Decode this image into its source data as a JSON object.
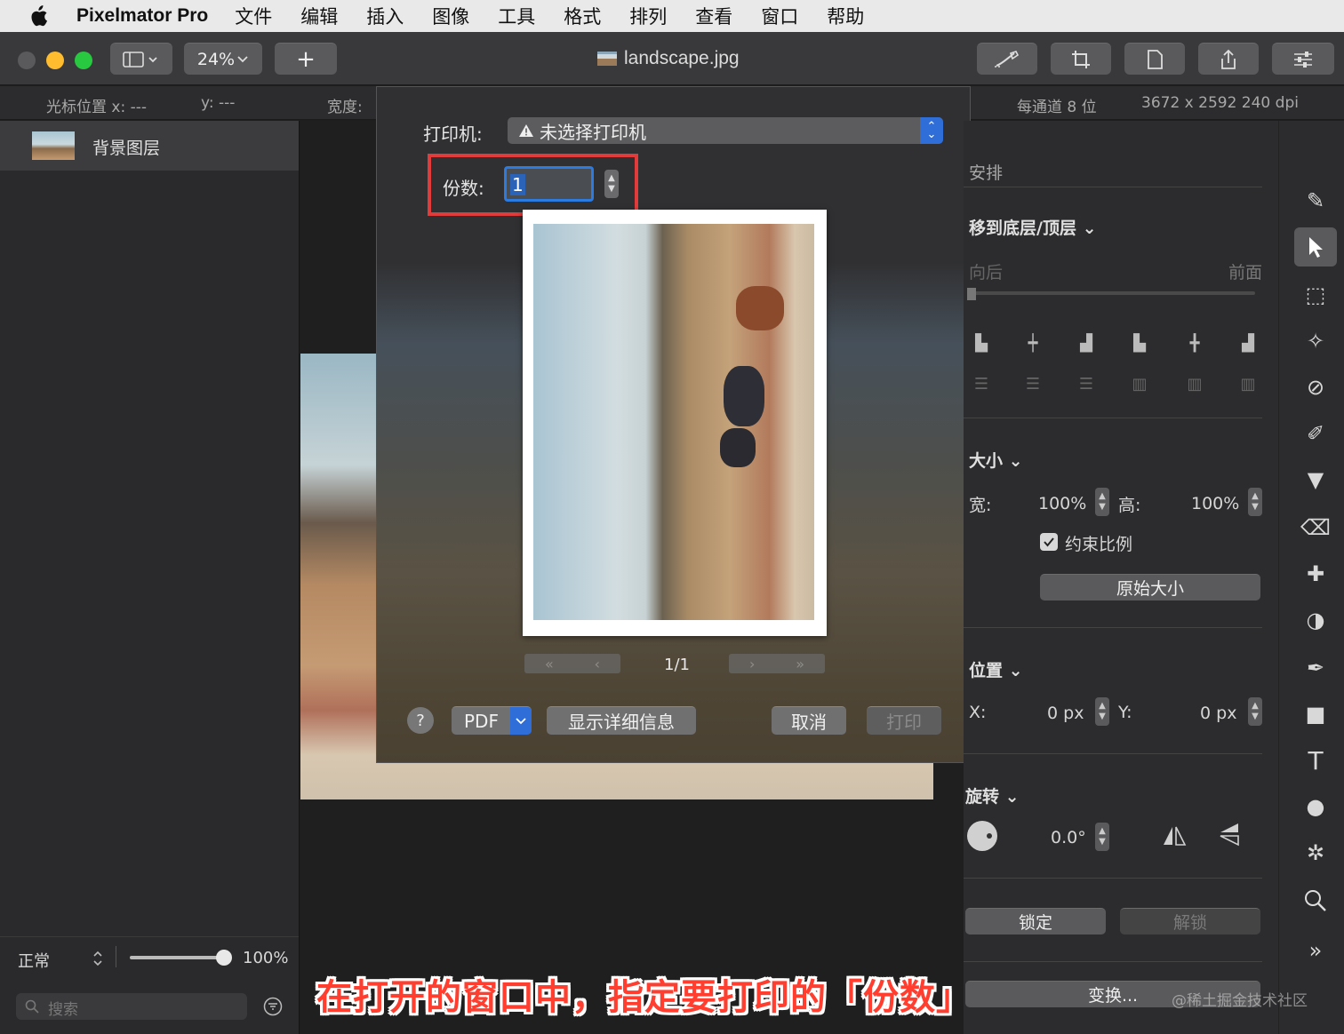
{
  "menubar": {
    "app_name": "Pixelmator Pro",
    "items": [
      "文件",
      "编辑",
      "插入",
      "图像",
      "工具",
      "格式",
      "排列",
      "查看",
      "窗口",
      "帮助"
    ]
  },
  "toolbar": {
    "zoom": "24%",
    "add_label": "+",
    "document_title": "landscape.jpg"
  },
  "infostrip": {
    "cursor_x": "光标位置 x:  ---",
    "cursor_y": "y:  ---",
    "width_label": "宽度:",
    "bits": "每通道 8 位",
    "size": "3672 x 2592 240 dpi"
  },
  "layers": {
    "items": [
      {
        "name": "背景图层"
      }
    ],
    "blend_mode": "正常",
    "opacity": "100%",
    "opacity_fraction": 1.0,
    "search_placeholder": "搜索"
  },
  "print_dialog": {
    "printer_label": "打印机:",
    "printer_value": "未选择打印机",
    "copies_label": "份数:",
    "copies_value": "1",
    "page_indicator": "1/1",
    "help_label": "?",
    "pdf_label": "PDF",
    "details_label": "显示详细信息",
    "cancel_label": "取消",
    "print_label": "打印"
  },
  "inspector": {
    "arrange_title": "安排",
    "move_label": "移到底层/顶层",
    "back_label": "向后",
    "front_label": "前面",
    "size_title": "大小",
    "width_label": "宽:",
    "width_value": "100%",
    "height_label": "高:",
    "height_value": "100%",
    "constrain_label": "约束比例",
    "original_size_label": "原始大小",
    "position_title": "位置",
    "x_label": "X:",
    "x_value": "0 px",
    "y_label": "Y:",
    "y_value": "0 px",
    "rotate_title": "旋转",
    "rotate_value": "0.0°",
    "lock_label": "锁定",
    "unlock_label": "解锁",
    "transform_label": "变换..."
  },
  "caption": "在打开的窗口中，指定要打印的「份数」",
  "watermark": "@稀土掘金技术社区",
  "colors": {
    "highlight_red": "#e23b3b",
    "accent_blue": "#2f6ed8",
    "traffic_red": "#ff5f57",
    "traffic_yellow": "#febc2e",
    "traffic_green": "#28c840"
  }
}
